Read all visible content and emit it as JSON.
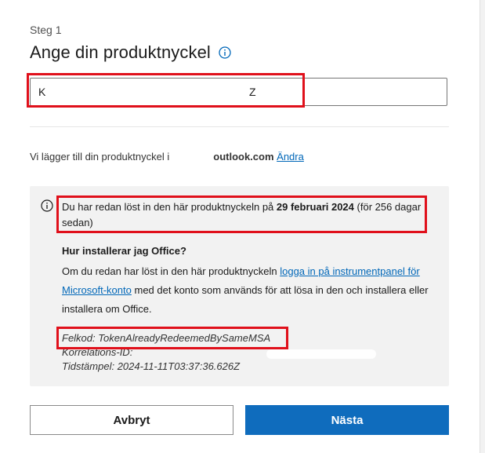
{
  "step": {
    "label": "Steg 1"
  },
  "header": {
    "title": "Ange din produktnyckel"
  },
  "product_key": {
    "prefix": "K",
    "suffix": "Z"
  },
  "account": {
    "text": "Vi lägger till din produktnyckel i",
    "email": "outlook.com",
    "change_link": "Ändra"
  },
  "notice": {
    "text_before": "Du har redan löst in den här produktnyckeln på ",
    "date": "29 februari 2024",
    "text_after": " (för 256 dagar sedan)"
  },
  "help": {
    "heading": "Hur installerar jag Office?",
    "text_before": "Om du redan har löst in den här produktnyckeln ",
    "link": "logga in på instrumentpanel för Microsoft-konto",
    "text_after": " med det konto som används för att lösa in den och installera eller installera om Office."
  },
  "diagnostics": {
    "error_code": "Felkod: TokenAlreadyRedeemedBySameMSA",
    "correlation_id": "Korrelations-ID:",
    "timestamp": "Tidstämpel: 2024-11-11T03:37:36.626Z"
  },
  "buttons": {
    "cancel": "Avbryt",
    "next": "Nästa"
  },
  "colors": {
    "accent": "#0f6cbd",
    "link": "#0067b8",
    "highlight": "#e0101b",
    "panel": "#f2f2f2"
  }
}
